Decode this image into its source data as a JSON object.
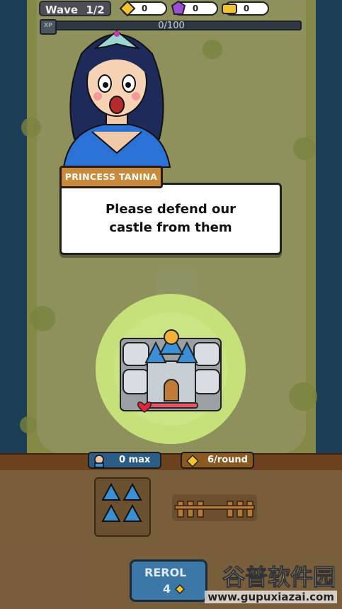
{
  "hud": {
    "wave_label": "Wave",
    "wave_value": "1/2",
    "gold": "0",
    "gems": "0",
    "tickets": "0",
    "xp_label": "XP",
    "xp_value": "0/100"
  },
  "dialog": {
    "speaker": "PRINCESS TANINA",
    "message": "Please defend our castle from them"
  },
  "castle": {
    "health_fraction": 1.0
  },
  "bottom": {
    "units_label": "0 max",
    "income_label": "6/round",
    "reroll_label": "REROL",
    "reroll_cost": "4"
  },
  "watermark": {
    "title": "谷普软件园",
    "url": "www.gupuxiazai.com"
  },
  "colors": {
    "grass": "#c7cc6a",
    "water": "#2a5f82",
    "nameplate": "#c98a3c",
    "reroll": "#3b78a8",
    "spotlight": "#c6e07a"
  }
}
